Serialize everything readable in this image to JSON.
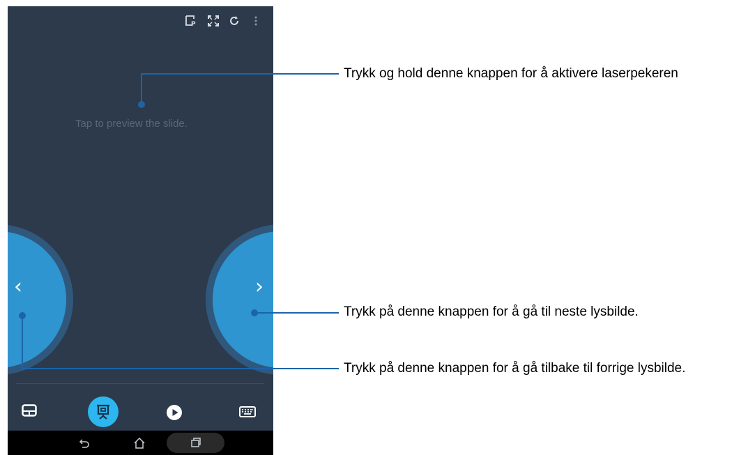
{
  "slide": {
    "hint": "Tap to preview the slide."
  },
  "topbar": {
    "icons": [
      "presenter-notes-icon",
      "fullscreen-icon",
      "refresh-icon",
      "more-vert-icon"
    ]
  },
  "nav": {
    "prev_glyph": "‹",
    "next_glyph": "›"
  },
  "bottom_bar": {
    "icons": [
      "touchpad-icon",
      "presentation-icon",
      "play-icon",
      "keyboard-icon"
    ],
    "active_icon": "presentation-icon",
    "active_color": "#2cb7f0"
  },
  "system_bar": {
    "icons": [
      "back-icon",
      "home-icon",
      "recents-icon"
    ]
  },
  "callouts": {
    "laser": "Trykk og hold denne knappen for å aktivere laserpekeren",
    "next": "Trykk på denne knappen for å gå til neste lysbilde.",
    "prev": "Trykk på denne knappen for å gå tilbake til forrige lysbilde."
  },
  "colors": {
    "screen_bg": "#2c3a4b",
    "nav_button": "#2e95d0",
    "callout_line": "#1c64a8"
  }
}
